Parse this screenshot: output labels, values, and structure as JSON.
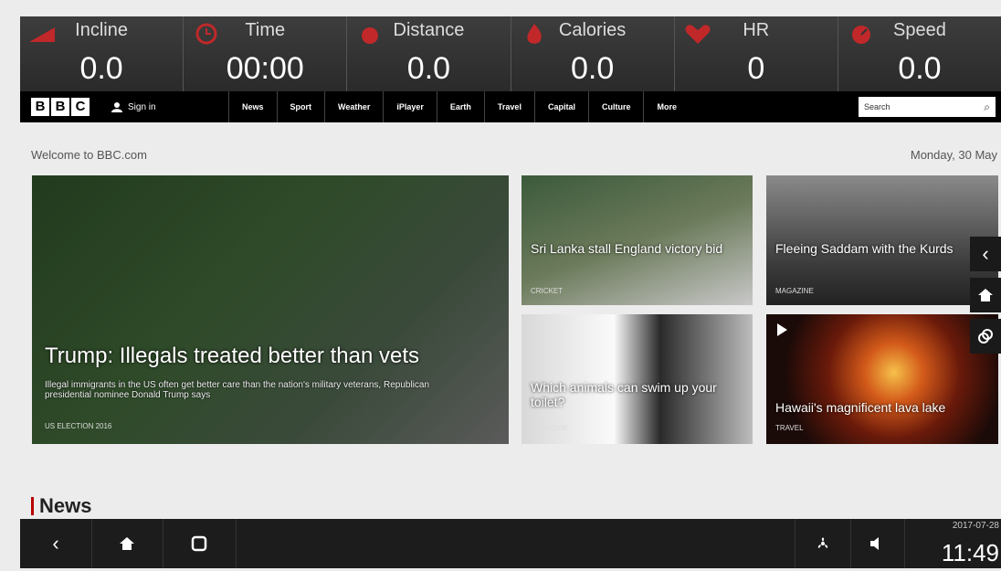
{
  "stats": [
    {
      "label": "Incline",
      "value": "0.0",
      "icon": "incline-icon"
    },
    {
      "label": "Time",
      "value": "00:00",
      "icon": "clock-icon"
    },
    {
      "label": "Distance",
      "value": "0.0",
      "icon": "distance-icon"
    },
    {
      "label": "Calories",
      "value": "0.0",
      "icon": "flame-icon"
    },
    {
      "label": "HR",
      "value": "0",
      "icon": "heart-icon"
    },
    {
      "label": "Speed",
      "value": "0.0",
      "icon": "speedometer-icon"
    }
  ],
  "nav": {
    "logo": [
      "B",
      "B",
      "C"
    ],
    "signin": "Sign in",
    "links": [
      "News",
      "Sport",
      "Weather",
      "iPlayer",
      "Earth",
      "Travel",
      "Capital",
      "Culture",
      "More"
    ],
    "search_placeholder": "Search"
  },
  "page": {
    "welcome": "Welcome to BBC.com",
    "date": "Monday, 30 May"
  },
  "stories": {
    "main": {
      "title": "Trump: Illegals treated better than vets",
      "summary": "Illegal immigrants in the US often get better care than the nation's military veterans, Republican presidential nominee Donald Trump says",
      "tag": "US ELECTION 2016"
    },
    "s1": {
      "title": "Sri Lanka stall England victory bid",
      "tag": "CRICKET"
    },
    "s2": {
      "title": "Fleeing Saddam with the Kurds",
      "tag": "MAGAZINE"
    },
    "s3": {
      "title": "Which animals can swim up your toilet?",
      "tag": "MAGAZINE"
    },
    "s4": {
      "title": "Hawaii's magnificent lava lake",
      "tag": "TRAVEL"
    }
  },
  "section": "News",
  "system": {
    "date": "2017-07-28",
    "time": "11:49"
  },
  "colors": {
    "accent": "#b80000",
    "stats_bg": "#333333",
    "nav_bg": "#000000"
  }
}
